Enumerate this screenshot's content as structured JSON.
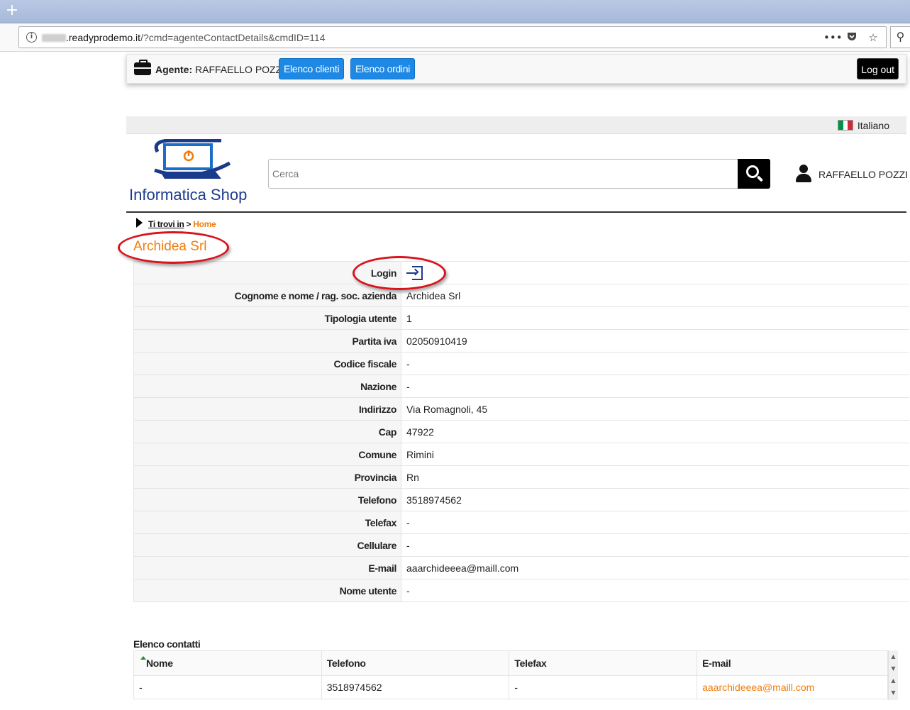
{
  "browser": {
    "new_tab_symbol": "+",
    "url_domain": ".readyprodemo.it",
    "url_path": "/?cmd=agenteContactDetails&cmdID=114",
    "icons": [
      "info-icon",
      "more-dots-icon",
      "pocket-icon",
      "bookmark-star-icon",
      "search-icon"
    ]
  },
  "agent_bar": {
    "label": "Agente:",
    "name": "RAFFAELLO POZZI",
    "clienti_button": "Elenco clienti",
    "ordini_button": "Elenco ordini",
    "logout_button": "Log out"
  },
  "language": {
    "label": "Italiano",
    "flag_colors": [
      "#009246",
      "#ffffff",
      "#ce2b37"
    ]
  },
  "header": {
    "logo_text": "Informatica Shop",
    "search_placeholder": "Cerca",
    "user_name": "RAFFAELLO POZZI"
  },
  "breadcrumb": {
    "label": "Ti trovi in",
    "separator": ">",
    "home": "Home"
  },
  "page_title": "Archidea Srl",
  "details": [
    {
      "label": "Login",
      "value": ""
    },
    {
      "label": "Cognome e nome / rag. soc. azienda",
      "value": "Archidea Srl"
    },
    {
      "label": "Tipologia utente",
      "value": "1"
    },
    {
      "label": "Partita iva",
      "value": "02050910419"
    },
    {
      "label": "Codice fiscale",
      "value": "-"
    },
    {
      "label": "Nazione",
      "value": "-"
    },
    {
      "label": "Indirizzo",
      "value": "Via Romagnoli, 45"
    },
    {
      "label": "Cap",
      "value": "47922"
    },
    {
      "label": "Comune",
      "value": "Rimini"
    },
    {
      "label": "Provincia",
      "value": "Rn"
    },
    {
      "label": "Telefono",
      "value": "3518974562"
    },
    {
      "label": "Telefax",
      "value": "-"
    },
    {
      "label": "Cellulare",
      "value": "-"
    },
    {
      "label": "E-mail",
      "value": "aaarchideeea@maill.com"
    },
    {
      "label": "Nome utente",
      "value": "-"
    }
  ],
  "contacts": {
    "title": "Elenco contatti",
    "headers": [
      "Nome",
      "Telefono",
      "Telefax",
      "E-mail"
    ],
    "rows": [
      [
        "-",
        "3518974562",
        "-",
        "aaarchideeea@maill.com"
      ]
    ]
  },
  "colors": {
    "accent_orange": "#f27c0a",
    "button_blue": "#1e88e5",
    "annotation_red": "#d8141c",
    "logo_blue": "#1a3a8c"
  }
}
